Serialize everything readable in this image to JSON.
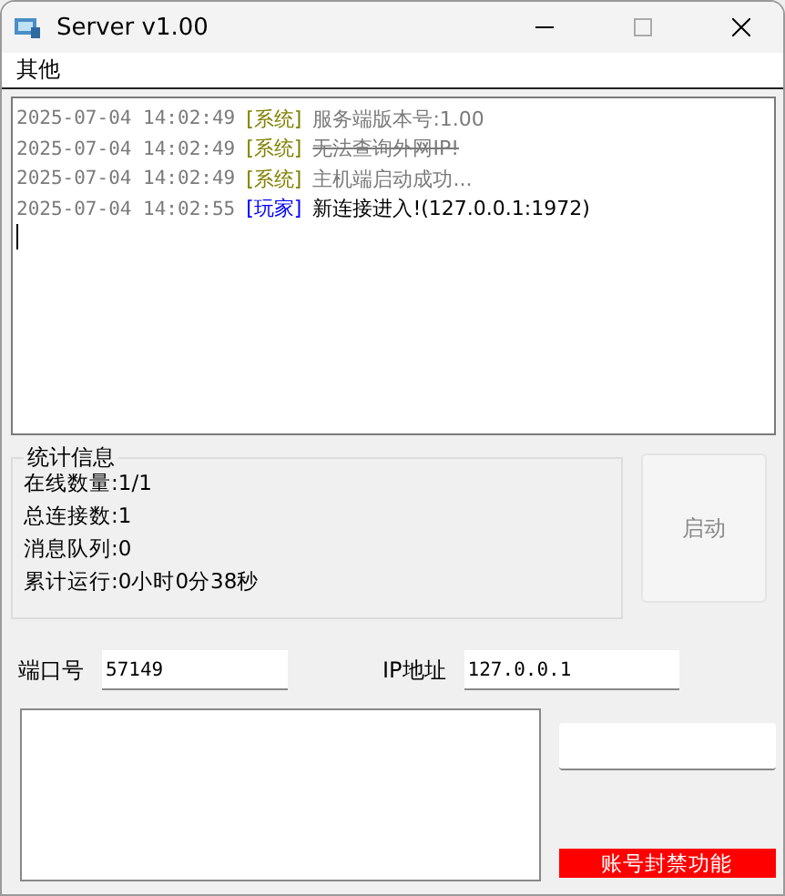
{
  "window": {
    "title": "Server v1.00"
  },
  "menu": [
    "其他"
  ],
  "log": [
    {
      "time": "2025-07-04 14:02:49",
      "tag": "[系统]",
      "kind": "system",
      "message": "服务端版本号:1.00",
      "strike": false
    },
    {
      "time": "2025-07-04 14:02:49",
      "tag": "[系统]",
      "kind": "system",
      "message": "无法查询外网IP!",
      "strike": true
    },
    {
      "time": "2025-07-04 14:02:49",
      "tag": "[系统]",
      "kind": "system",
      "message": "主机端启动成功...",
      "strike": false
    },
    {
      "time": "2025-07-04 14:02:55",
      "tag": "[玩家]",
      "kind": "player",
      "message": "新连接进入!(127.0.0.1:1972)",
      "strike": false
    }
  ],
  "stats": {
    "title": "统计信息",
    "lines": [
      "在线数量:1/1",
      "总连接数:1",
      "消息队列:0",
      "累计运行:0小时0分38秒"
    ]
  },
  "start_button": {
    "label": "启动",
    "disabled": true
  },
  "port": {
    "label": "端口号",
    "value": "57149"
  },
  "ip": {
    "label": "IP地址",
    "value": "127.0.0.1"
  },
  "ban_label": "账号封禁功能"
}
